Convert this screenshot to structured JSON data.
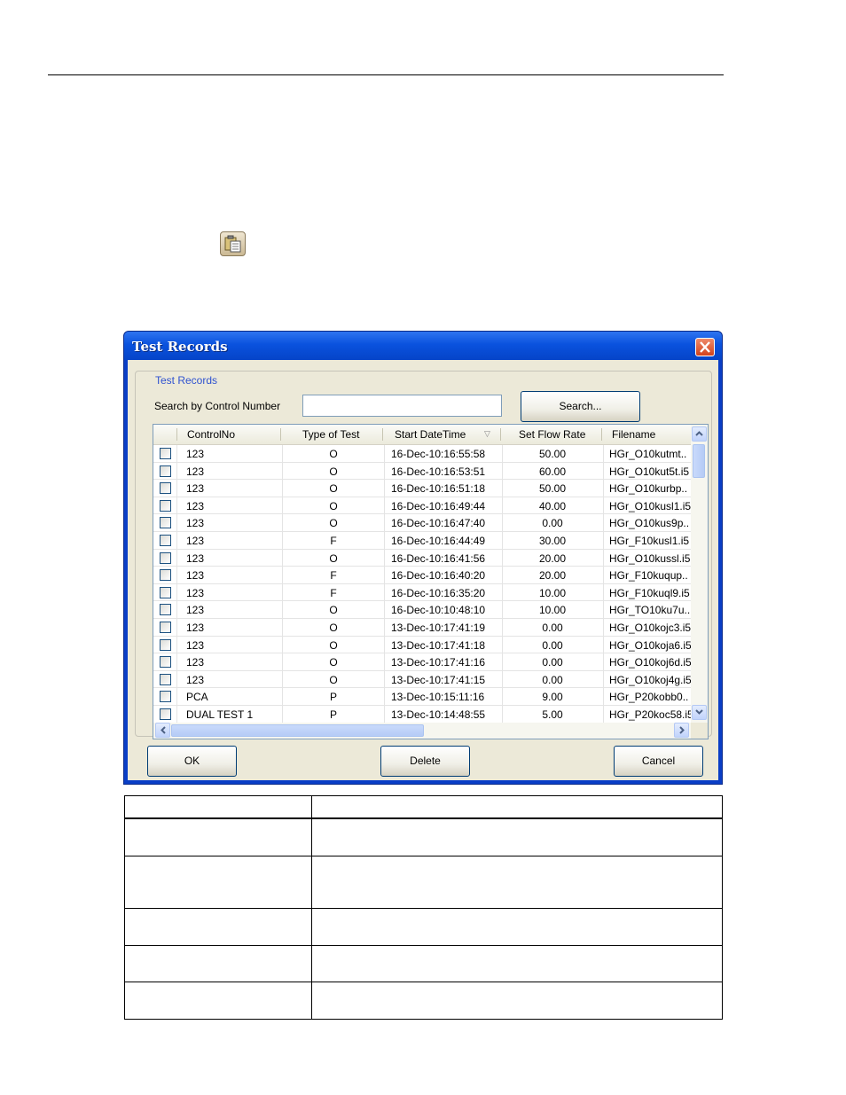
{
  "dialog": {
    "title": "Test Records",
    "group_label": "Test Records",
    "search_label": "Search by Control Number",
    "search_value": "",
    "search_button": "Search...",
    "ok_button": "OK",
    "delete_button": "Delete",
    "cancel_button": "Cancel"
  },
  "table": {
    "columns": [
      "ControlNo",
      "Type of Test",
      "Start DateTime",
      "Set Flow Rate",
      "Filename"
    ],
    "rows": [
      [
        "123",
        "O",
        "16-Dec-10:16:55:58",
        "50.00",
        "HGr_O10kutmt.."
      ],
      [
        "123",
        "O",
        "16-Dec-10:16:53:51",
        "60.00",
        "HGr_O10kut5t.i5"
      ],
      [
        "123",
        "O",
        "16-Dec-10:16:51:18",
        "50.00",
        "HGr_O10kurbp.."
      ],
      [
        "123",
        "O",
        "16-Dec-10:16:49:44",
        "40.00",
        "HGr_O10kusl1.i5"
      ],
      [
        "123",
        "O",
        "16-Dec-10:16:47:40",
        "0.00",
        "HGr_O10kus9p.."
      ],
      [
        "123",
        "F",
        "16-Dec-10:16:44:49",
        "30.00",
        "HGr_F10kusl1.i5"
      ],
      [
        "123",
        "O",
        "16-Dec-10:16:41:56",
        "20.00",
        "HGr_O10kussl.i5"
      ],
      [
        "123",
        "F",
        "16-Dec-10:16:40:20",
        "20.00",
        "HGr_F10kuqup.."
      ],
      [
        "123",
        "F",
        "16-Dec-10:16:35:20",
        "10.00",
        "HGr_F10kuql9.i5"
      ],
      [
        "123",
        "O",
        "16-Dec-10:10:48:10",
        "10.00",
        "HGr_TO10ku7u.."
      ],
      [
        "123",
        "O",
        "13-Dec-10:17:41:19",
        "0.00",
        "HGr_O10kojc3.i5"
      ],
      [
        "123",
        "O",
        "13-Dec-10:17:41:18",
        "0.00",
        "HGr_O10koja6.i5"
      ],
      [
        "123",
        "O",
        "13-Dec-10:17:41:16",
        "0.00",
        "HGr_O10koj6d.i5"
      ],
      [
        "123",
        "O",
        "13-Dec-10:17:41:15",
        "0.00",
        "HGr_O10koj4g.i5"
      ],
      [
        "PCA",
        "P",
        "13-Dec-10:15:11:16",
        "9.00",
        "HGr_P20kobb0.."
      ],
      [
        "DUAL TEST 1",
        "P",
        "13-Dec-10:14:48:55",
        "5.00",
        "HGr_P20koc58.i5"
      ]
    ]
  }
}
